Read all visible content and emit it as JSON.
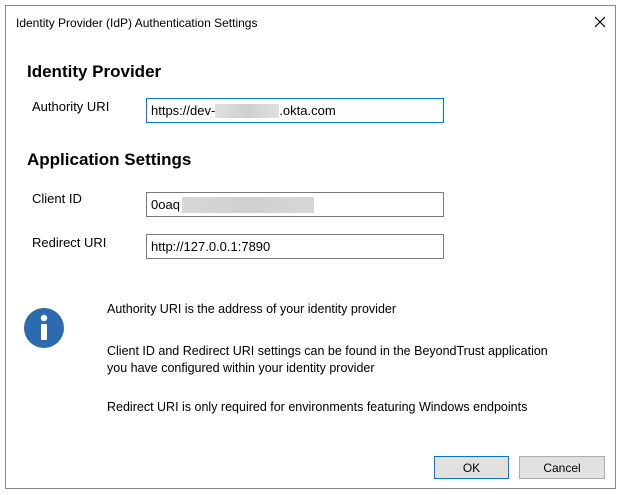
{
  "dialog": {
    "title": "Identity Provider (IdP) Authentication Settings",
    "close_glyph": "✕"
  },
  "identity_provider": {
    "heading": "Identity Provider",
    "authority_uri_label": "Authority URI",
    "authority_uri_prefix": "https://dev-",
    "authority_uri_suffix": ".okta.com"
  },
  "application_settings": {
    "heading": "Application Settings",
    "client_id_label": "Client ID",
    "client_id_value": "0oaq",
    "redirect_uri_label": "Redirect URI",
    "redirect_uri_value": "http://127.0.0.1:7890"
  },
  "info": {
    "icon": "info-icon",
    "icon_color": "#2c6bb0",
    "line1": "Authority URI is the address of your identity provider",
    "line2": "Client ID and Redirect URI settings can be found in the BeyondTrust application you have configured within your identity provider",
    "line3": "Redirect URI is only required for environments featuring Windows endpoints"
  },
  "buttons": {
    "ok_label": "OK",
    "cancel_label": "Cancel"
  }
}
